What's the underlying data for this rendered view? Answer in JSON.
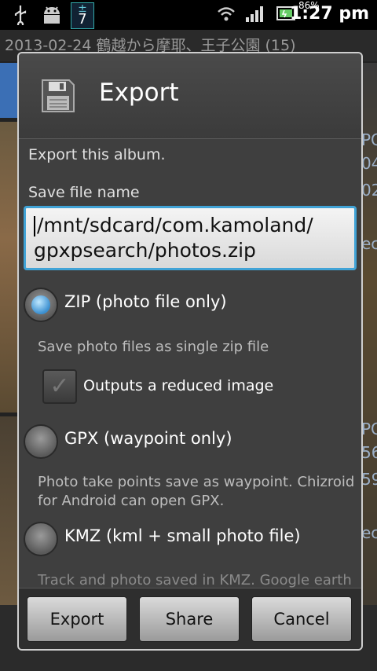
{
  "status_bar": {
    "time": "1:27 pm",
    "battery_pct": "86%",
    "calendar_badge": "7",
    "calendar_top": "±"
  },
  "album": {
    "header": "2013-02-24 鶴越から摩耶、王子公園 (15)",
    "side_texts": [
      "PG",
      "04",
      "02",
      "ec",
      "PG",
      "56",
      "59",
      "ec"
    ]
  },
  "dialog": {
    "title": "Export",
    "intro": "Export this album.",
    "file_label": "Save file name",
    "file_value": "/mnt/sdcard/com.kamoland/gpxpsearch/photos.zip",
    "file_value_line1": "/mnt/sdcard/com.kamoland/",
    "file_value_line2": "gpxpsearch/photos.zip",
    "options": [
      {
        "label": "ZIP (photo file only)",
        "checked": true
      },
      {
        "label": "GPX (waypoint only)",
        "checked": false
      },
      {
        "label": "KMZ (kml + small photo file)",
        "checked": false
      }
    ],
    "zip_desc": "Save photo files as single zip file",
    "reduced_checkbox_label": "Outputs a reduced image",
    "reduced_checked": true,
    "gpx_desc_line1": "Photo take points save as waypoint. Chizroid",
    "gpx_desc_line2": "for Android can open GPX.",
    "kmz_desc_partial": "Track and photo saved in KMZ. Google earth",
    "buttons": {
      "export": "Export",
      "share": "Share",
      "cancel": "Cancel"
    }
  },
  "colors": {
    "accent": "#41a3d6",
    "dialog_bg": "#3f3f3f"
  }
}
